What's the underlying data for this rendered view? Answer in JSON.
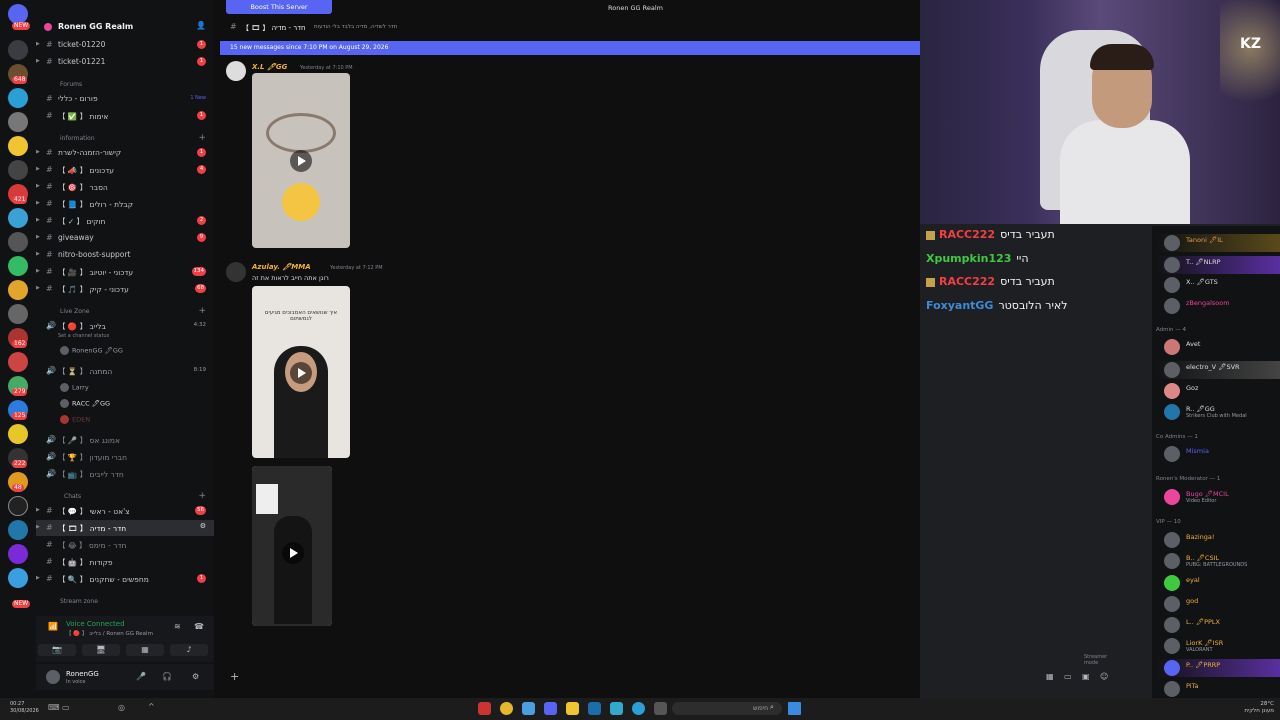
{
  "server": {
    "name": "Ronen GG Realm",
    "channels_top": [
      {
        "label": "ticket-01220",
        "badge": "1"
      },
      {
        "label": "ticket-01221",
        "badge": "1"
      }
    ],
    "cat_forums": "Forums",
    "forums": [
      {
        "label": "פורום - כללי",
        "badge": "1 New"
      },
      {
        "label": "【 ✅ 】 אימות",
        "badge": "1"
      }
    ],
    "cat_information": "information",
    "information": [
      {
        "label": "קישור-הזמנה-לשרת",
        "badge": "1"
      },
      {
        "label": "【 📣 】 עדכונים",
        "badge": "4"
      },
      {
        "label": "【 🎯 】 הסבר",
        "badge": ""
      },
      {
        "label": "【 📘 】 קבלת - רולים",
        "badge": ""
      },
      {
        "label": "【 ✓ 】 חוקים",
        "badge": "2"
      },
      {
        "label": "giveaway",
        "badge": "9"
      },
      {
        "label": "nitro-boost-support",
        "badge": ""
      },
      {
        "label": "【 🎥 】 עדכוני - יוטיוב",
        "badge": "134"
      },
      {
        "label": "【 🎵 】 עדכוני - קיק",
        "badge": "68"
      }
    ],
    "cat_live": "Live Zone",
    "live": {
      "channel1": "【 🔴 】 בלייב",
      "channel1_time": "4:32",
      "channel1_status": "Set a channel status",
      "channel1_user": "RonenGG 🖊GG",
      "channel2": "【 ⏳ 】 המתנה",
      "channel2_time": "8:19",
      "users": [
        "Larry",
        "RACC 🖊GG",
        "EDEN"
      ],
      "channel3": "【 🎤 】 אמונג אס",
      "channel4": "【 🏆 】 חברי מועדון",
      "channel5": "【 📺 】 חדר לייבים"
    },
    "cat_chats": "Chats",
    "chats": [
      {
        "label": "【 💬 】 צ'אט - ראשי",
        "badge": "56",
        "active": false
      },
      {
        "label": "【 🎞 】 חדר - מדיה",
        "badge": "",
        "active": true
      },
      {
        "label": "【 😂 】 חדר - מימס",
        "badge": "",
        "active": false
      },
      {
        "label": "【 🤖 】 פקודות",
        "badge": "",
        "active": false
      },
      {
        "label": "【 🔍 】 מחפשים - שחקנים",
        "badge": "1",
        "active": false
      }
    ],
    "cat_stream": "Stream zone"
  },
  "voice": {
    "title": "Voice Connected",
    "sub": "【 🔴 】 בלייב / Ronen GG Realm"
  },
  "user": {
    "name": "RonenGG",
    "status": "In voice"
  },
  "rail_badges": [
    "NEW",
    "648",
    "421",
    "162",
    "279",
    "125",
    "222",
    "48",
    "NEW"
  ],
  "chat": {
    "boost": "Boost This Server",
    "title": "Ronen GG Realm",
    "channel": "【 🎞 】 חדר - מדיה",
    "topic": "חדר לשדיה, מדיה בלבד בלי הודעות",
    "new_messages": "15 new messages since 7:10 PM on August 29, 2026",
    "msg1_author": "X.L 🖊GG",
    "msg1_time": "Yesterday at 7:10 PM",
    "msg2_author": "Azulay. 🖊MMA",
    "msg2_time": "Yesterday at 7:12 PM",
    "msg2_text": "רונן אתה חייב לראות את זה",
    "video2_caption": "איך שנושאים האמבוכים מגיעים לגמשתום",
    "composer": "",
    "streamer_mode": "Streamer mode",
    "colors": {
      "accent": "#5865f2",
      "author": "#f0b232"
    }
  },
  "stream_chat": [
    {
      "name": "RACC222",
      "text": "תעביר בדיס",
      "color": "#f23f43",
      "icon": true
    },
    {
      "name": "Xpumpkin123",
      "text": "היי",
      "color": "#3ec940",
      "icon": false
    },
    {
      "name": "RACC222",
      "text": "תעביר בדיס",
      "color": "#f23f43",
      "icon": true
    },
    {
      "name": "FoxyantGG",
      "text": "לאיר הלובסטר",
      "color": "#3b8bd9",
      "icon": false
    }
  ],
  "cam_label": "KZ",
  "members": {
    "top": [
      {
        "name": "Tanoni 🖊IL",
        "sub": ""
      },
      {
        "name": "T.. 🖊NLRP",
        "sub": ""
      },
      {
        "name": "X.. 🖊GTS",
        "sub": ""
      },
      {
        "name": "zBengalsoom",
        "sub": ""
      }
    ],
    "admin_header": "Admin — 4",
    "admin": [
      {
        "name": "Avet",
        "sub": ""
      },
      {
        "name": "electro_V 🖊SVR",
        "sub": ""
      },
      {
        "name": "Goz",
        "sub": ""
      },
      {
        "name": "R.. 🖊GG",
        "sub": "Strikers Club with Medal"
      }
    ],
    "coadmin_header": "Co Admins — 1",
    "coadmin": [
      {
        "name": "Mismia",
        "sub": ""
      }
    ],
    "mod_header": "Ronen's Moderator — 1",
    "mod": [
      {
        "name": "Bugo 🖊MCIL",
        "sub": "Video Editor"
      }
    ],
    "vip_header": "VIP — 10",
    "vip": [
      {
        "name": "Bazinga!",
        "sub": ""
      },
      {
        "name": "B.. 🖊CSIL",
        "sub": "PUBG: BATTLEGROUNDS"
      },
      {
        "name": "eyal",
        "sub": ""
      },
      {
        "name": "god",
        "sub": ""
      },
      {
        "name": "L.. 🖊PPLX",
        "sub": ""
      },
      {
        "name": "LiorK 🖊ISR",
        "sub": "VALORANT"
      },
      {
        "name": "P.. 🖊PRRP",
        "sub": ""
      },
      {
        "name": "PiTa",
        "sub": ""
      }
    ]
  },
  "taskbar": {
    "time": "00:27",
    "date": "30/08/2026",
    "search": "חיפוש",
    "weather_temp": "28°C",
    "weather_text": "מעונן חלקית"
  }
}
